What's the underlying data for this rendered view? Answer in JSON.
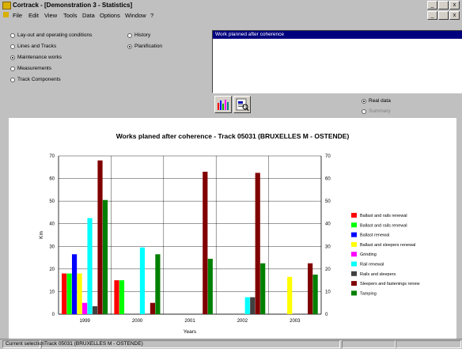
{
  "window": {
    "title": "Cortrack - [Demonstration 3 - Statistics]",
    "buttons": [
      "_",
      " ",
      "x"
    ],
    "child_buttons": [
      "_",
      " ",
      "x"
    ]
  },
  "menu": [
    "File",
    "Edit",
    "View",
    "Tools",
    "Data",
    "Options",
    "Window",
    "?"
  ],
  "categories": [
    {
      "label": "Lay-out and operating conditions",
      "selected": false
    },
    {
      "label": "Lines and Tracks",
      "selected": false
    },
    {
      "label": "Maintenance works",
      "selected": true
    },
    {
      "label": "Measurements",
      "selected": false
    },
    {
      "label": "Track Components",
      "selected": false
    }
  ],
  "modes": [
    {
      "label": "History",
      "selected": false
    },
    {
      "label": "Planification",
      "selected": true
    }
  ],
  "list": {
    "selected_item": "Work planned after coherence"
  },
  "toolbar_icons": [
    "bar-chart-icon",
    "print-preview-icon"
  ],
  "data_options": [
    {
      "label": "Real data",
      "selected": true
    },
    {
      "label": "Summary",
      "selected": false
    }
  ],
  "chart_data": {
    "type": "bar",
    "title": "Works planed after coherence - Track 05031 (BRUXELLES M - OSTENDE)",
    "xlabel": "Years",
    "ylabel": "Km",
    "ylim": [
      0,
      70
    ],
    "yticks": [
      0,
      10,
      20,
      30,
      40,
      50,
      60,
      70
    ],
    "categories": [
      "1999",
      "2000",
      "2001",
      "2002",
      "2003"
    ],
    "series": [
      {
        "name": "Ballast and rails renewal",
        "color": "#ff0000",
        "values": [
          18,
          15,
          0,
          0,
          0
        ]
      },
      {
        "name": "Ballast and rails renewal",
        "color": "#00ff00",
        "values": [
          18,
          15,
          0,
          0,
          0
        ]
      },
      {
        "name": "Ballast renewal",
        "color": "#0000ff",
        "values": [
          26.5,
          0,
          0,
          0,
          0
        ]
      },
      {
        "name": "Ballast and sleepers renewal",
        "color": "#ffff00",
        "values": [
          18,
          0,
          0,
          0,
          16.5
        ]
      },
      {
        "name": "Grinding",
        "color": "#ff00ff",
        "values": [
          5,
          0,
          0,
          0,
          0
        ]
      },
      {
        "name": "Rail renewal",
        "color": "#00ffff",
        "values": [
          42.5,
          29.5,
          0,
          7.5,
          0
        ]
      },
      {
        "name": "Rails and sleepers",
        "color": "#404040",
        "values": [
          3.5,
          0,
          0,
          7.5,
          0
        ]
      },
      {
        "name": "Sleepers and fastenings renew",
        "color": "#800000",
        "values": [
          68,
          5,
          63,
          62.5,
          22.5
        ]
      },
      {
        "name": "Tamping",
        "color": "#008000",
        "values": [
          50.5,
          26.5,
          24.5,
          22.5,
          17.5
        ]
      }
    ]
  },
  "status": {
    "label": "Current selection",
    "value": "Track 05031 (BRUXELLES M - OSTENDE)"
  }
}
